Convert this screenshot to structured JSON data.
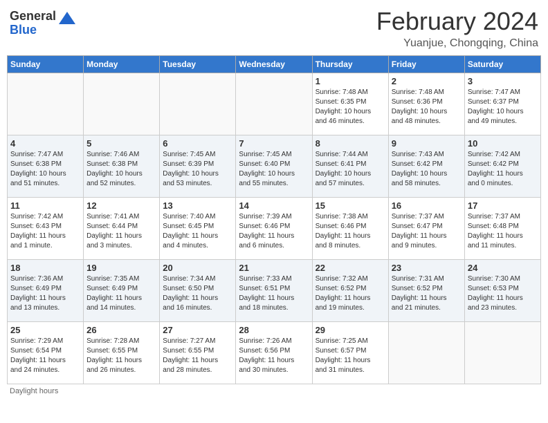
{
  "header": {
    "logo_general": "General",
    "logo_blue": "Blue",
    "month_title": "February 2024",
    "location": "Yuanjue, Chongqing, China"
  },
  "days_of_week": [
    "Sunday",
    "Monday",
    "Tuesday",
    "Wednesday",
    "Thursday",
    "Friday",
    "Saturday"
  ],
  "weeks": [
    [
      {
        "day": "",
        "info": ""
      },
      {
        "day": "",
        "info": ""
      },
      {
        "day": "",
        "info": ""
      },
      {
        "day": "",
        "info": ""
      },
      {
        "day": "1",
        "info": "Sunrise: 7:48 AM\nSunset: 6:35 PM\nDaylight: 10 hours\nand 46 minutes."
      },
      {
        "day": "2",
        "info": "Sunrise: 7:48 AM\nSunset: 6:36 PM\nDaylight: 10 hours\nand 48 minutes."
      },
      {
        "day": "3",
        "info": "Sunrise: 7:47 AM\nSunset: 6:37 PM\nDaylight: 10 hours\nand 49 minutes."
      }
    ],
    [
      {
        "day": "4",
        "info": "Sunrise: 7:47 AM\nSunset: 6:38 PM\nDaylight: 10 hours\nand 51 minutes."
      },
      {
        "day": "5",
        "info": "Sunrise: 7:46 AM\nSunset: 6:38 PM\nDaylight: 10 hours\nand 52 minutes."
      },
      {
        "day": "6",
        "info": "Sunrise: 7:45 AM\nSunset: 6:39 PM\nDaylight: 10 hours\nand 53 minutes."
      },
      {
        "day": "7",
        "info": "Sunrise: 7:45 AM\nSunset: 6:40 PM\nDaylight: 10 hours\nand 55 minutes."
      },
      {
        "day": "8",
        "info": "Sunrise: 7:44 AM\nSunset: 6:41 PM\nDaylight: 10 hours\nand 57 minutes."
      },
      {
        "day": "9",
        "info": "Sunrise: 7:43 AM\nSunset: 6:42 PM\nDaylight: 10 hours\nand 58 minutes."
      },
      {
        "day": "10",
        "info": "Sunrise: 7:42 AM\nSunset: 6:42 PM\nDaylight: 11 hours\nand 0 minutes."
      }
    ],
    [
      {
        "day": "11",
        "info": "Sunrise: 7:42 AM\nSunset: 6:43 PM\nDaylight: 11 hours\nand 1 minute."
      },
      {
        "day": "12",
        "info": "Sunrise: 7:41 AM\nSunset: 6:44 PM\nDaylight: 11 hours\nand 3 minutes."
      },
      {
        "day": "13",
        "info": "Sunrise: 7:40 AM\nSunset: 6:45 PM\nDaylight: 11 hours\nand 4 minutes."
      },
      {
        "day": "14",
        "info": "Sunrise: 7:39 AM\nSunset: 6:46 PM\nDaylight: 11 hours\nand 6 minutes."
      },
      {
        "day": "15",
        "info": "Sunrise: 7:38 AM\nSunset: 6:46 PM\nDaylight: 11 hours\nand 8 minutes."
      },
      {
        "day": "16",
        "info": "Sunrise: 7:37 AM\nSunset: 6:47 PM\nDaylight: 11 hours\nand 9 minutes."
      },
      {
        "day": "17",
        "info": "Sunrise: 7:37 AM\nSunset: 6:48 PM\nDaylight: 11 hours\nand 11 minutes."
      }
    ],
    [
      {
        "day": "18",
        "info": "Sunrise: 7:36 AM\nSunset: 6:49 PM\nDaylight: 11 hours\nand 13 minutes."
      },
      {
        "day": "19",
        "info": "Sunrise: 7:35 AM\nSunset: 6:49 PM\nDaylight: 11 hours\nand 14 minutes."
      },
      {
        "day": "20",
        "info": "Sunrise: 7:34 AM\nSunset: 6:50 PM\nDaylight: 11 hours\nand 16 minutes."
      },
      {
        "day": "21",
        "info": "Sunrise: 7:33 AM\nSunset: 6:51 PM\nDaylight: 11 hours\nand 18 minutes."
      },
      {
        "day": "22",
        "info": "Sunrise: 7:32 AM\nSunset: 6:52 PM\nDaylight: 11 hours\nand 19 minutes."
      },
      {
        "day": "23",
        "info": "Sunrise: 7:31 AM\nSunset: 6:52 PM\nDaylight: 11 hours\nand 21 minutes."
      },
      {
        "day": "24",
        "info": "Sunrise: 7:30 AM\nSunset: 6:53 PM\nDaylight: 11 hours\nand 23 minutes."
      }
    ],
    [
      {
        "day": "25",
        "info": "Sunrise: 7:29 AM\nSunset: 6:54 PM\nDaylight: 11 hours\nand 24 minutes."
      },
      {
        "day": "26",
        "info": "Sunrise: 7:28 AM\nSunset: 6:55 PM\nDaylight: 11 hours\nand 26 minutes."
      },
      {
        "day": "27",
        "info": "Sunrise: 7:27 AM\nSunset: 6:55 PM\nDaylight: 11 hours\nand 28 minutes."
      },
      {
        "day": "28",
        "info": "Sunrise: 7:26 AM\nSunset: 6:56 PM\nDaylight: 11 hours\nand 30 minutes."
      },
      {
        "day": "29",
        "info": "Sunrise: 7:25 AM\nSunset: 6:57 PM\nDaylight: 11 hours\nand 31 minutes."
      },
      {
        "day": "",
        "info": ""
      },
      {
        "day": "",
        "info": ""
      }
    ]
  ],
  "footer": {
    "note": "Daylight hours"
  }
}
